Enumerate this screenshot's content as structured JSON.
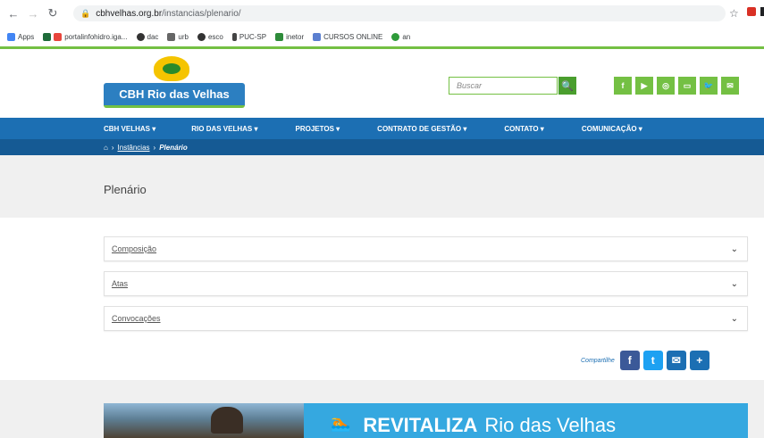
{
  "browser": {
    "url_domain": "cbhvelhas.org.br",
    "url_path": "/instancias/plenario/",
    "bookmarks": [
      "Apps",
      "portalinfohidro.iga...",
      "dac",
      "urb",
      "esco",
      "PUC-SP",
      "inetor",
      "CURSOS ONLINE",
      "an"
    ]
  },
  "header": {
    "logo_text": "CBH Rio das Velhas",
    "search_placeholder": "Buscar",
    "social": [
      "f",
      "▶",
      "◎",
      "▭",
      "🐦",
      "✉"
    ]
  },
  "nav": {
    "items": [
      "CBH VELHAS ▾",
      "RIO DAS VELHAS ▾",
      "PROJETOS ▾",
      "CONTRATO DE GESTÃO ▾",
      "CONTATO ▾",
      "COMUNICAÇÃO ▾"
    ],
    "breadcrumb": {
      "home_icon": "home-icon",
      "separator": "›",
      "link": "Instâncias",
      "current": "Plenário"
    }
  },
  "page": {
    "title": "Plenário",
    "accordion": [
      "Composição",
      "Atas",
      "Convocações"
    ]
  },
  "share": {
    "label": "Compartilhe",
    "buttons": [
      "f",
      "t",
      "✉",
      "+"
    ]
  },
  "banner": {
    "text": "REVITALIZA",
    "river": "Rio das Velhas"
  },
  "colors": {
    "nav_blue": "#1c6fb3",
    "nav_dark": "#155a94",
    "green": "#74c043",
    "banner_blue": "#35a8e0"
  }
}
